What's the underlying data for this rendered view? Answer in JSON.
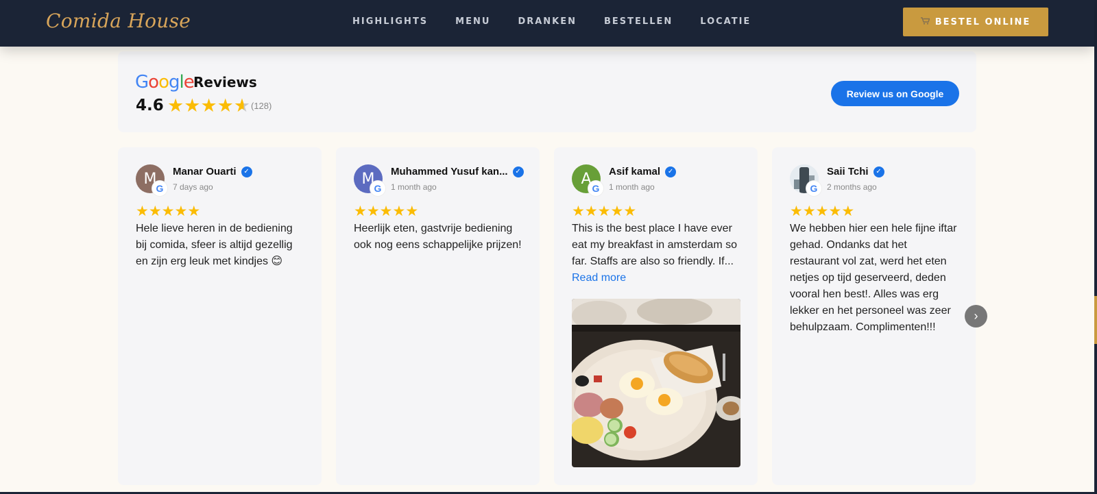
{
  "nav": {
    "logo": "Comida House",
    "links": [
      "HIGHLIGHTS",
      "MENU",
      "DRANKEN",
      "BESTELLEN",
      "LOCATIE"
    ],
    "order_button": "BESTEL ONLINE",
    "order_icon": "cart-icon"
  },
  "summary": {
    "brand_letters": [
      "G",
      "o",
      "o",
      "g",
      "l",
      "e"
    ],
    "brand_colors": [
      "#4285f4",
      "#ea4335",
      "#fbbc04",
      "#4285f4",
      "#34a853",
      "#ea4335"
    ],
    "title": "Reviews",
    "rating": "4.6",
    "rating_value": 4.6,
    "count": "(128)",
    "button": "Review us on Google",
    "star_color": "#fbbc04"
  },
  "reviews": [
    {
      "initial": "M",
      "avatar_color": "#8d6e63",
      "name": "Manar Ouarti",
      "time": "7 days ago",
      "stars": 5,
      "text": "Hele lieve heren in de bediening bij comida, sfeer is altijd gezellig en zijn erg leuk met kindjes 😊"
    },
    {
      "initial": "M",
      "avatar_color": "#5c6bc0",
      "name": "Muhammed Yusuf kan...",
      "time": "1 month ago",
      "stars": 5,
      "text": "Heerlijk eten, gastvrije bediening ook nog eens schappelijke prijzen!"
    },
    {
      "initial": "A",
      "avatar_color": "#689f38",
      "name": "Asif kamal",
      "time": "1 month ago",
      "stars": 5,
      "text": "This is the best place I have ever eat my breakfast in amsterdam so far. Staffs are also so friendly. If...",
      "read_more": "Read more"
    },
    {
      "initial": "",
      "avatar_color": "#dfe6ec",
      "name": "Saii Tchi",
      "time": "2 months ago",
      "stars": 5,
      "text": "We hebben hier een hele fijne iftar gehad. Ondanks dat het restaurant vol zat, werd het eten netjes op tijd geserveerd, deden vooral hen best!. Alles was erg lekker en het personeel was zeer behulpzaam. Complimenten!!!"
    }
  ],
  "google_badge_letter": "G",
  "verified_mark": "✓",
  "star_glyph": "★",
  "next_arrow": "›"
}
